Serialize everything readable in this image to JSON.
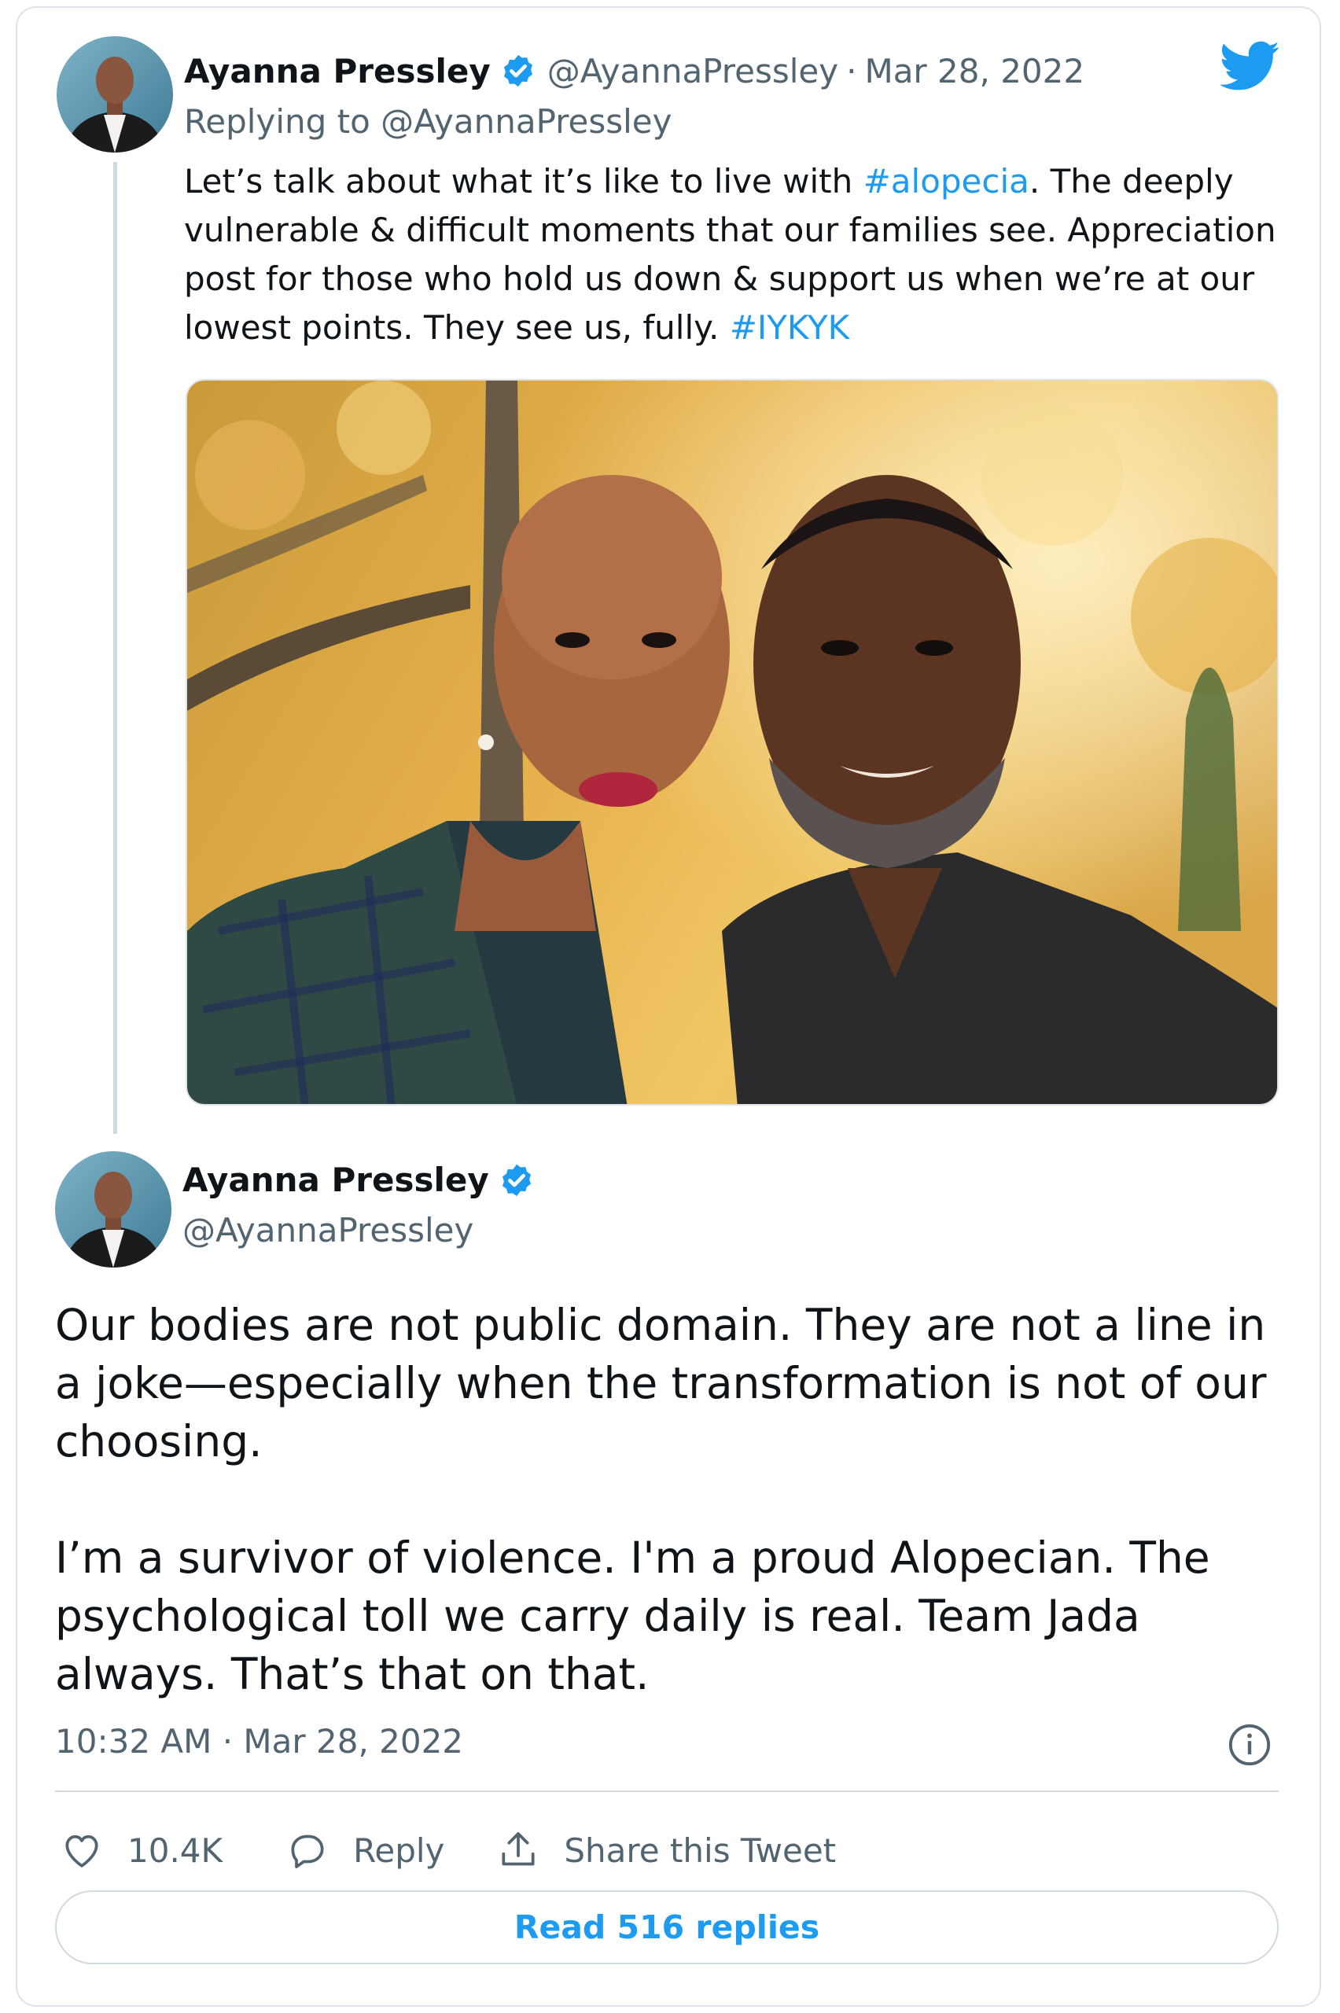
{
  "reply_tweet": {
    "author_name": "Ayanna Pressley",
    "handle": "@AyannaPressley",
    "separator": "·",
    "date": "Mar 28, 2022",
    "replying_prefix": "Replying to",
    "replying_to": "@AyannaPressley",
    "text_parts": [
      "Let’s talk about what it’s like to live with ",
      "#alopecia",
      ". The deeply vulnerable & difficult moments that our families see. Appreciation post for those who hold us down & support us when we’re at our lowest points. They see us, fully. ",
      "#IYKYK"
    ],
    "verified_icon": "verified-badge-icon",
    "brand_icon": "twitter-bird-icon"
  },
  "main_tweet": {
    "author_name": "Ayanna Pressley",
    "handle": "@AyannaPressley",
    "paragraphs": [
      "Our bodies are not public domain. They are not a line in a joke—especially when the transformation is not of our choosing.",
      "I’m a survivor of violence. I'm a proud Alopecian. The psychological toll we carry daily is real. Team Jada always. That’s that on that."
    ],
    "timestamp": "10:32 AM · Mar 28, 2022",
    "info_icon": "info-icon"
  },
  "actions": {
    "like_count": "10.4K",
    "reply_label": "Reply",
    "share_label": "Share this Tweet",
    "read_replies": "Read 516 replies"
  },
  "colors": {
    "accent": "#1d9bf0",
    "secondary_text": "#536471",
    "primary_text": "#0f1419",
    "border": "#cfd9de"
  }
}
